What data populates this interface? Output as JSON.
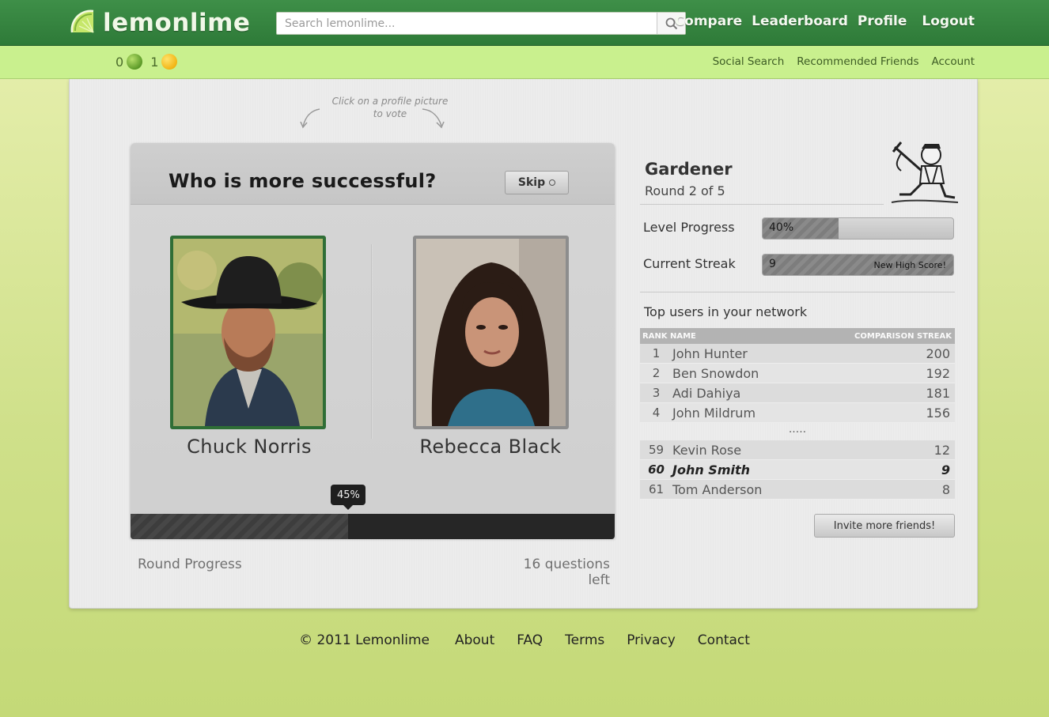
{
  "header": {
    "brand": "lemonlime",
    "search_placeholder": "Search lemonlime...",
    "nav": [
      "Compare",
      "Leaderboard",
      "Profile",
      "Logout"
    ]
  },
  "subbar": {
    "lime_count": "0",
    "lemon_count": "1",
    "links": [
      "Social Search",
      "Recommended Friends",
      "Account"
    ]
  },
  "hint": "Click on a profile picture to vote",
  "question": {
    "title": "Who is more successful?",
    "skip_label": "Skip",
    "left_name": "Chuck Norris",
    "right_name": "Rebecca Black",
    "progress_label": "45%",
    "progress_value": 45,
    "round_label": "Round Progress",
    "questions_left": "16 questions left"
  },
  "status": {
    "rank_title": "Gardener",
    "round": "Round 2 of 5",
    "level_label": "Level Progress",
    "level_value": "40%",
    "level_fraction": 40,
    "streak_label": "Current Streak",
    "streak_value": "9",
    "streak_note": "New High Score!"
  },
  "leaderboard": {
    "title": "Top users in your network",
    "columns": [
      "RANK",
      "NAME",
      "COMPARISON STREAK"
    ],
    "top_rows": [
      {
        "rank": "1",
        "name": "John Hunter",
        "streak": "200"
      },
      {
        "rank": "2",
        "name": "Ben Snowdon",
        "streak": "192"
      },
      {
        "rank": "3",
        "name": "Adi Dahiya",
        "streak": "181"
      },
      {
        "rank": "4",
        "name": "John Mildrum",
        "streak": "156"
      }
    ],
    "ellipsis": ".....",
    "near_rows": [
      {
        "rank": "59",
        "name": "Kevin Rose",
        "streak": "12"
      },
      {
        "rank": "60",
        "name": "John Smith",
        "streak": "9"
      },
      {
        "rank": "61",
        "name": "Tom Anderson",
        "streak": "8"
      }
    ],
    "invite_label": "Invite more friends!"
  },
  "footer": {
    "copyright": "© 2011 Lemonlime",
    "links": [
      "About",
      "FAQ",
      "Terms",
      "Privacy",
      "Contact"
    ]
  },
  "colors": {
    "header_green": "#3e8f48",
    "subbar_green": "#c9f08e",
    "left_frame": "#2f6e36"
  }
}
